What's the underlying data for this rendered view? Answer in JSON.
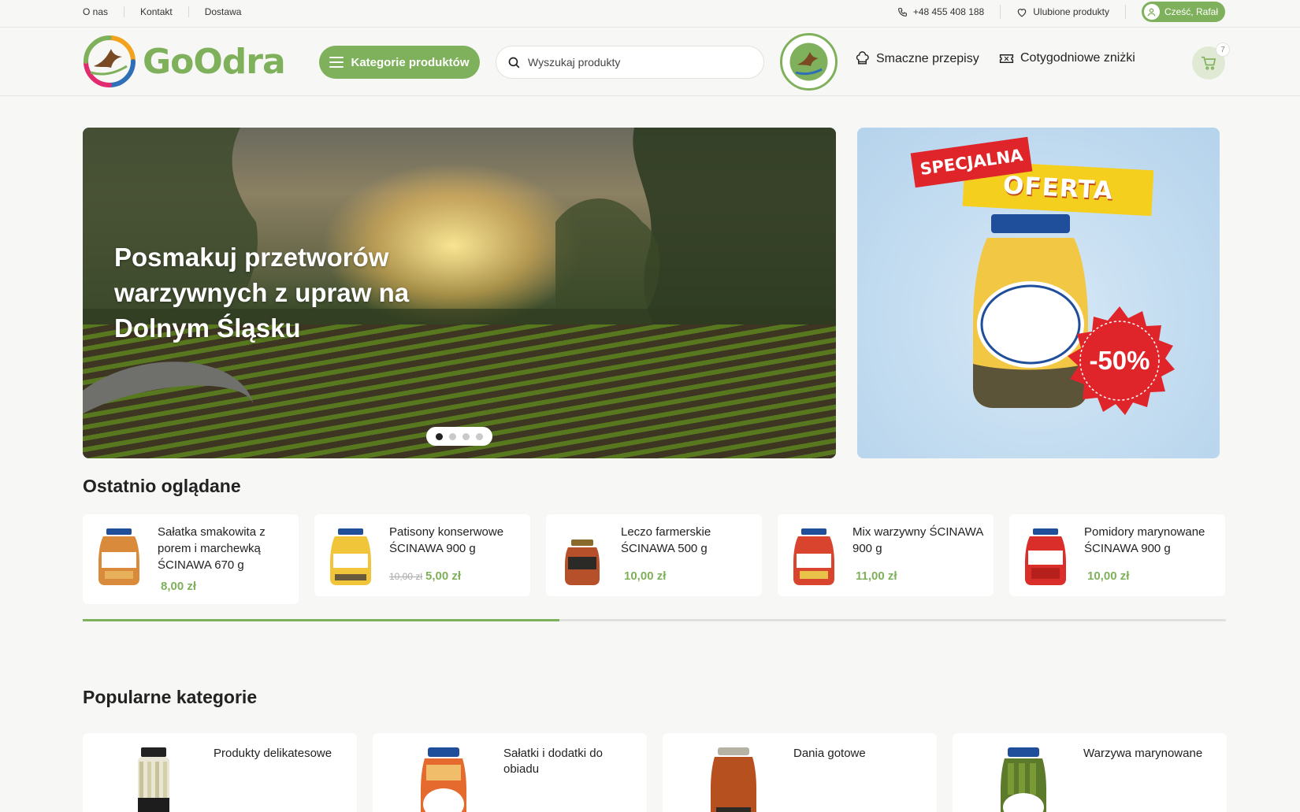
{
  "topbar": {
    "links": [
      "O nas",
      "Kontakt",
      "Dostawa"
    ],
    "phone": "+48 455 408 188",
    "favorites": "Ulubione produkty",
    "greeting": "Cześć, Rafał"
  },
  "header": {
    "logo_text": "GoOdra",
    "categories_button": "Kategorie produktów",
    "search_placeholder": "Wyszukaj produkty",
    "nav": [
      "Smaczne przepisy",
      "Cotygodniowe zniżki"
    ],
    "cart_count": "7"
  },
  "colors": {
    "accent": "#7fb05b",
    "background": "#f7f7f5",
    "promo_red": "#e0252a",
    "promo_yellow": "#f5cf1e"
  },
  "hero": {
    "title": "Posmakuj przetworów warzywnych z upraw na Dolnym Śląsku",
    "slides": 4,
    "active_slide": 1
  },
  "promo": {
    "label_top": "SPECJALNA",
    "label_bottom": "OFERTA",
    "discount": "-50%"
  },
  "recent": {
    "title": "Ostatnio oglądane",
    "items": [
      {
        "name": "Sałatka smakowita z porem i marchewką ŚCINAWA 670 g",
        "price": "8,00 zł",
        "old_price": ""
      },
      {
        "name": "Patisony konserwowe ŚCINAWA 900 g",
        "price": "5,00 zł",
        "old_price": "10,00 zł"
      },
      {
        "name": "Leczo farmerskie ŚCINAWA 500 g",
        "price": "10,00 zł",
        "old_price": ""
      },
      {
        "name": "Mix warzywny ŚCINAWA 900 g",
        "price": "11,00 zł",
        "old_price": ""
      },
      {
        "name": "Pomidory marynowane ŚCINAWA 900 g",
        "price": "10,00 zł",
        "old_price": ""
      }
    ],
    "scroll_progress": 0.417
  },
  "popular": {
    "title": "Popularne kategorie",
    "items": [
      {
        "name": "Produkty delikatesowe"
      },
      {
        "name": "Sałatki i dodatki do obiadu"
      },
      {
        "name": "Dania gotowe"
      },
      {
        "name": "Warzywa marynowane"
      }
    ]
  }
}
